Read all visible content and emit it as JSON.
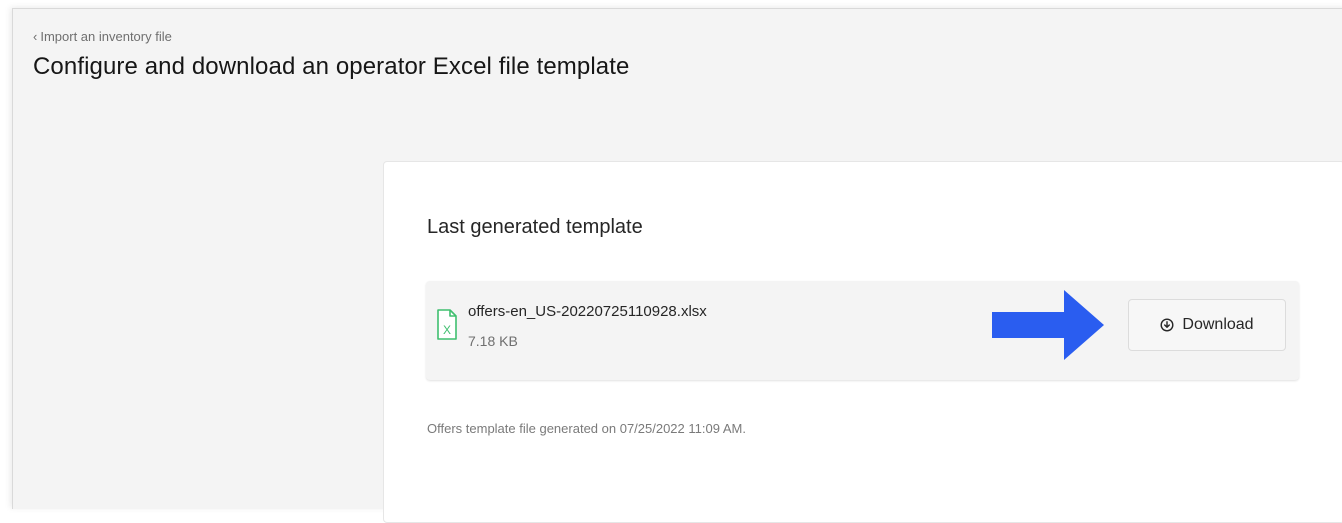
{
  "header": {
    "back_link": "Import an inventory file",
    "back_icon": "chevron-left-icon",
    "title": "Configure and download an operator Excel file template"
  },
  "card": {
    "heading": "Last generated template",
    "file": {
      "icon": "excel-file-icon",
      "icon_color": "#3fbf6f",
      "name": "offers-en_US-20220725110928.xlsx",
      "size": "7.18 KB"
    },
    "download_button": {
      "icon": "download-icon",
      "label": "Download"
    },
    "generated_note": "Offers template file generated on 07/25/2022 11:09 AM."
  },
  "annotation": {
    "arrow_icon": "arrow-right-icon",
    "arrow_color": "#2a5df0"
  }
}
